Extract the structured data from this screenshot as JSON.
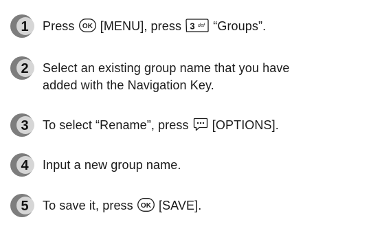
{
  "steps": [
    {
      "number": "1",
      "before_ok": "Press ",
      "ok_key": "OK",
      "menu": " [MENU], press ",
      "key3_digit": "3",
      "key3_letters": "def",
      "after_key3": " “Groups”."
    },
    {
      "number": "2",
      "line1": "Select an existing group name that you have",
      "line2": "added with the Navigation Key."
    },
    {
      "number": "3",
      "before_options": "To select “Rename”, press ",
      "options_icon": "options-key-icon",
      "after_options": " [OPTIONS]."
    },
    {
      "number": "4",
      "text": "Input a new group name."
    },
    {
      "number": "5",
      "before_ok": "To save it, press ",
      "ok_key": "OK",
      "after_ok": " [SAVE]."
    }
  ],
  "colors": {
    "badge_dark": "#7d7d7d",
    "badge_light": "#d6d6d6",
    "badge_number": "#111111"
  }
}
